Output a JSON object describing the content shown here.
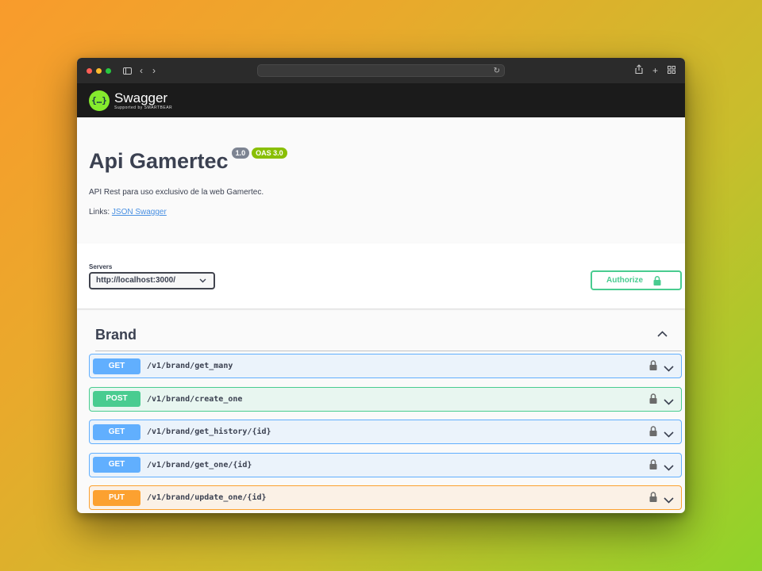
{
  "browser": {
    "url": ""
  },
  "swagger_header": {
    "logo_glyph": "{…}",
    "logo_word": "Swagger",
    "logo_sub": "Supported by SMARTBEAR"
  },
  "info": {
    "title": "Api Gamertec",
    "version_badge": "1.0",
    "oas_badge": "OAS 3.0",
    "description": "API Rest para uso exclusivo de la web Gamertec.",
    "links_label": "Links:",
    "link_text": "JSON Swagger"
  },
  "servers": {
    "label": "Servers",
    "selected": "http://localhost:3000/"
  },
  "authorize": {
    "label": "Authorize"
  },
  "tag": {
    "title": "Brand"
  },
  "operations": [
    {
      "method": "GET",
      "path": "/v1/brand/get_many"
    },
    {
      "method": "POST",
      "path": "/v1/brand/create_one"
    },
    {
      "method": "GET",
      "path": "/v1/brand/get_history/{id}"
    },
    {
      "method": "GET",
      "path": "/v1/brand/get_one/{id}"
    },
    {
      "method": "PUT",
      "path": "/v1/brand/update_one/{id}"
    }
  ],
  "colors": {
    "get": "#61affe",
    "post": "#49cc90",
    "put": "#fca130",
    "swagger_green": "#85ea2d"
  }
}
